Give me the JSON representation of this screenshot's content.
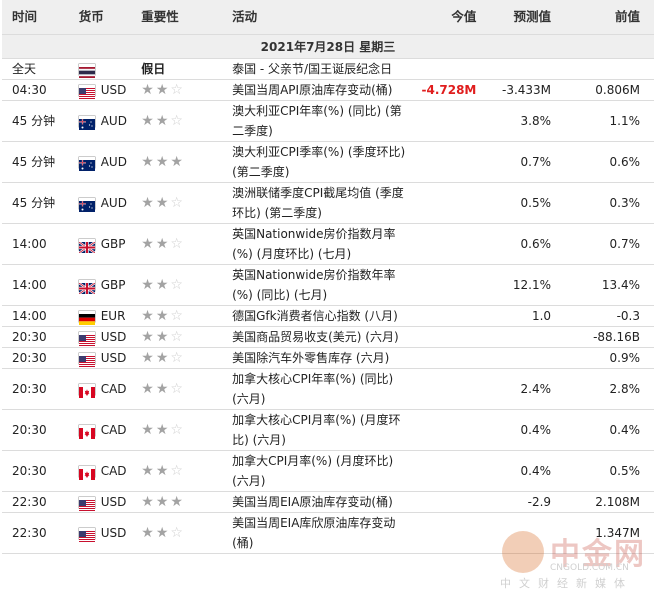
{
  "header": {
    "time": "时间",
    "currency": "货币",
    "importance": "重要性",
    "event": "活动",
    "actual": "今值",
    "forecast": "预测值",
    "previous": "前值"
  },
  "date_label": "2021年7月28日 星期三",
  "rows": [
    {
      "time": "全天",
      "flag": "th",
      "currency": "",
      "importance": "假日",
      "event": "泰国 - 父亲节/国王诞辰纪念日",
      "actual": "",
      "forecast": "",
      "previous": ""
    },
    {
      "time": "04:30",
      "flag": "us",
      "currency": "USD",
      "stars": 2,
      "event": "美国当周API原油库存变动(桶)",
      "actual": "-4.728M",
      "actual_color": "red",
      "forecast": "-3.433M",
      "previous": "0.806M"
    },
    {
      "time": "45 分钟",
      "flag": "au",
      "currency": "AUD",
      "stars": 2,
      "event": "澳大利亚CPI年率(%) (同比) (第二季度)",
      "actual": "",
      "forecast": "3.8%",
      "previous": "1.1%"
    },
    {
      "time": "45 分钟",
      "flag": "au",
      "currency": "AUD",
      "stars": 3,
      "event": "澳大利亚CPI季率(%) (季度环比) (第二季度)",
      "actual": "",
      "forecast": "0.7%",
      "previous": "0.6%"
    },
    {
      "time": "45 分钟",
      "flag": "au",
      "currency": "AUD",
      "stars": 2,
      "event": "澳洲联储季度CPI截尾均值 (季度环比) (第二季度)",
      "actual": "",
      "forecast": "0.5%",
      "previous": "0.3%"
    },
    {
      "time": "14:00",
      "flag": "gb",
      "currency": "GBP",
      "stars": 2,
      "event": "英国Nationwide房价指数月率(%) (月度环比) (七月)",
      "actual": "",
      "forecast": "0.6%",
      "previous": "0.7%"
    },
    {
      "time": "14:00",
      "flag": "gb",
      "currency": "GBP",
      "stars": 2,
      "event": "英国Nationwide房价指数年率(%) (同比) (七月)",
      "actual": "",
      "forecast": "12.1%",
      "previous": "13.4%"
    },
    {
      "time": "14:00",
      "flag": "de",
      "currency": "EUR",
      "stars": 2,
      "event": "德国Gfk消费者信心指数 (八月)",
      "actual": "",
      "forecast": "1.0",
      "previous": "-0.3"
    },
    {
      "time": "20:30",
      "flag": "us",
      "currency": "USD",
      "stars": 2,
      "event": "美国商品贸易收支(美元) (六月)",
      "actual": "",
      "forecast": "",
      "previous": "-88.16B"
    },
    {
      "time": "20:30",
      "flag": "us",
      "currency": "USD",
      "stars": 2,
      "event": "美国除汽车外零售库存 (六月)",
      "actual": "",
      "forecast": "",
      "previous": "0.9%"
    },
    {
      "time": "20:30",
      "flag": "ca",
      "currency": "CAD",
      "stars": 2,
      "event": "加拿大核心CPI年率(%) (同比) (六月)",
      "actual": "",
      "forecast": "2.4%",
      "previous": "2.8%"
    },
    {
      "time": "20:30",
      "flag": "ca",
      "currency": "CAD",
      "stars": 2,
      "event": "加拿大核心CPI月率(%) (月度环比) (六月)",
      "actual": "",
      "forecast": "0.4%",
      "previous": "0.4%"
    },
    {
      "time": "20:30",
      "flag": "ca",
      "currency": "CAD",
      "stars": 2,
      "event": "加拿大CPI月率(%) (月度环比) (六月)",
      "actual": "",
      "forecast": "0.4%",
      "previous": "0.5%"
    },
    {
      "time": "22:30",
      "flag": "us",
      "currency": "USD",
      "stars": 3,
      "event": "美国当周EIA原油库存变动(桶)",
      "actual": "",
      "forecast": "-2.9",
      "previous": "2.108M"
    },
    {
      "time": "22:30",
      "flag": "us",
      "currency": "USD",
      "stars": 2,
      "event": "美国当周EIA库欣原油库存变动(桶)",
      "actual": "",
      "forecast": "",
      "previous": "1.347M"
    }
  ],
  "watermark": {
    "brand": "中金网",
    "url": "CNGOLD.COM.CN",
    "tagline": "中文财经新媒体"
  },
  "colors": {
    "negative_actual": "#e01d1d",
    "header_bg": "#efefef"
  }
}
